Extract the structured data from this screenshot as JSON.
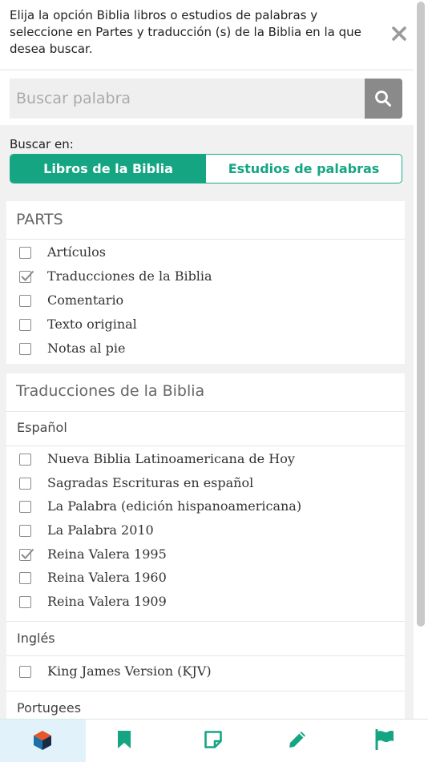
{
  "intro": {
    "text": "Elija la opción Biblia libros o estudios de palabras y seleccione en Partes y traducción (s) de la Biblia en la que desea buscar."
  },
  "search": {
    "placeholder": "Buscar palabra",
    "value": ""
  },
  "scope": {
    "label": "Buscar en:",
    "options": [
      "Libros de la Biblia",
      "Estudios de palabras"
    ],
    "selected": "Libros de la Biblia"
  },
  "parts": {
    "title": "PARTS",
    "items": [
      {
        "label": "Artículos",
        "checked": false
      },
      {
        "label": "Traducciones de la Biblia",
        "checked": true
      },
      {
        "label": "Comentario",
        "checked": false
      },
      {
        "label": "Texto original",
        "checked": false
      },
      {
        "label": "Notas al pie",
        "checked": false
      }
    ]
  },
  "translations": {
    "title": "Traducciones de la Biblia",
    "groups": [
      {
        "name": "Español",
        "items": [
          {
            "label": "Nueva Biblia Latinoamericana de Hoy",
            "checked": false
          },
          {
            "label": "Sagradas Escrituras en español",
            "checked": false
          },
          {
            "label": "La Palabra (edición hispanoamericana)",
            "checked": false
          },
          {
            "label": "La Palabra 2010",
            "checked": false
          },
          {
            "label": "Reina Valera 1995",
            "checked": true
          },
          {
            "label": "Reina Valera 1960",
            "checked": false
          },
          {
            "label": "Reina Valera 1909",
            "checked": false
          }
        ]
      },
      {
        "name": "Inglés",
        "items": [
          {
            "label": "King James Version (KJV)",
            "checked": false
          }
        ]
      },
      {
        "name": "Portugees",
        "items": []
      }
    ]
  },
  "nav": {
    "tabs": [
      {
        "icon": "cube-logo-icon",
        "active": true
      },
      {
        "icon": "bookmark-icon",
        "active": false
      },
      {
        "icon": "note-icon",
        "active": false
      },
      {
        "icon": "pencil-icon",
        "active": false
      },
      {
        "icon": "flag-icon",
        "active": false
      }
    ]
  },
  "colors": {
    "accent": "#15a583",
    "search_button": "#8a8a8a",
    "nav_active_bg": "#e2f2fa"
  }
}
